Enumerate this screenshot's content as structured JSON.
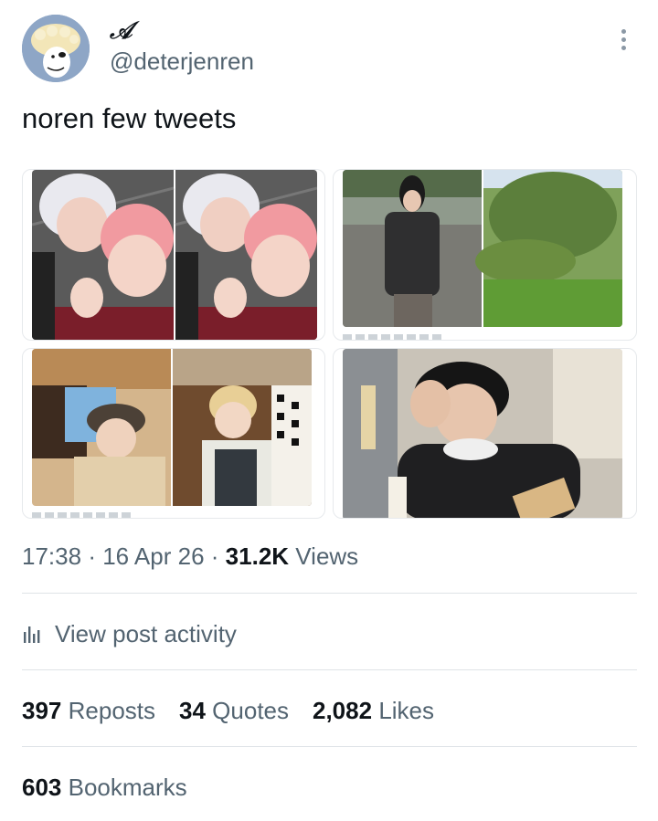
{
  "author": {
    "display_name": "𝒜",
    "handle": "@deterjenren",
    "avatar_icon": "cartoon-dog-avatar-icon"
  },
  "post": {
    "text": "noren few tweets",
    "media": [
      {
        "name": "embedded-tweet-image-1",
        "description_icon": "selfie-photo"
      },
      {
        "name": "embedded-tweet-image-2",
        "description_icon": "outfit-photo"
      },
      {
        "name": "embedded-tweet-image-3",
        "description_icon": "cafe-photo"
      },
      {
        "name": "embedded-tweet-image-4",
        "description_icon": "street-photo"
      }
    ]
  },
  "meta": {
    "time": "17:38",
    "date": "16 Apr 26",
    "views_count": "31.2K",
    "views_label": "Views",
    "separator": "·"
  },
  "activity": {
    "label": "View post activity",
    "icon": "bar-chart-icon"
  },
  "stats": {
    "reposts": {
      "count": "397",
      "label": "Reposts"
    },
    "quotes": {
      "count": "34",
      "label": "Quotes"
    },
    "likes": {
      "count": "2,082",
      "label": "Likes"
    },
    "bookmarks": {
      "count": "603",
      "label": "Bookmarks"
    }
  },
  "colors": {
    "text_primary": "#0f1419",
    "text_secondary": "#536471",
    "divider": "#dfe3e7",
    "avatar_bg": "#8ea6c6"
  }
}
